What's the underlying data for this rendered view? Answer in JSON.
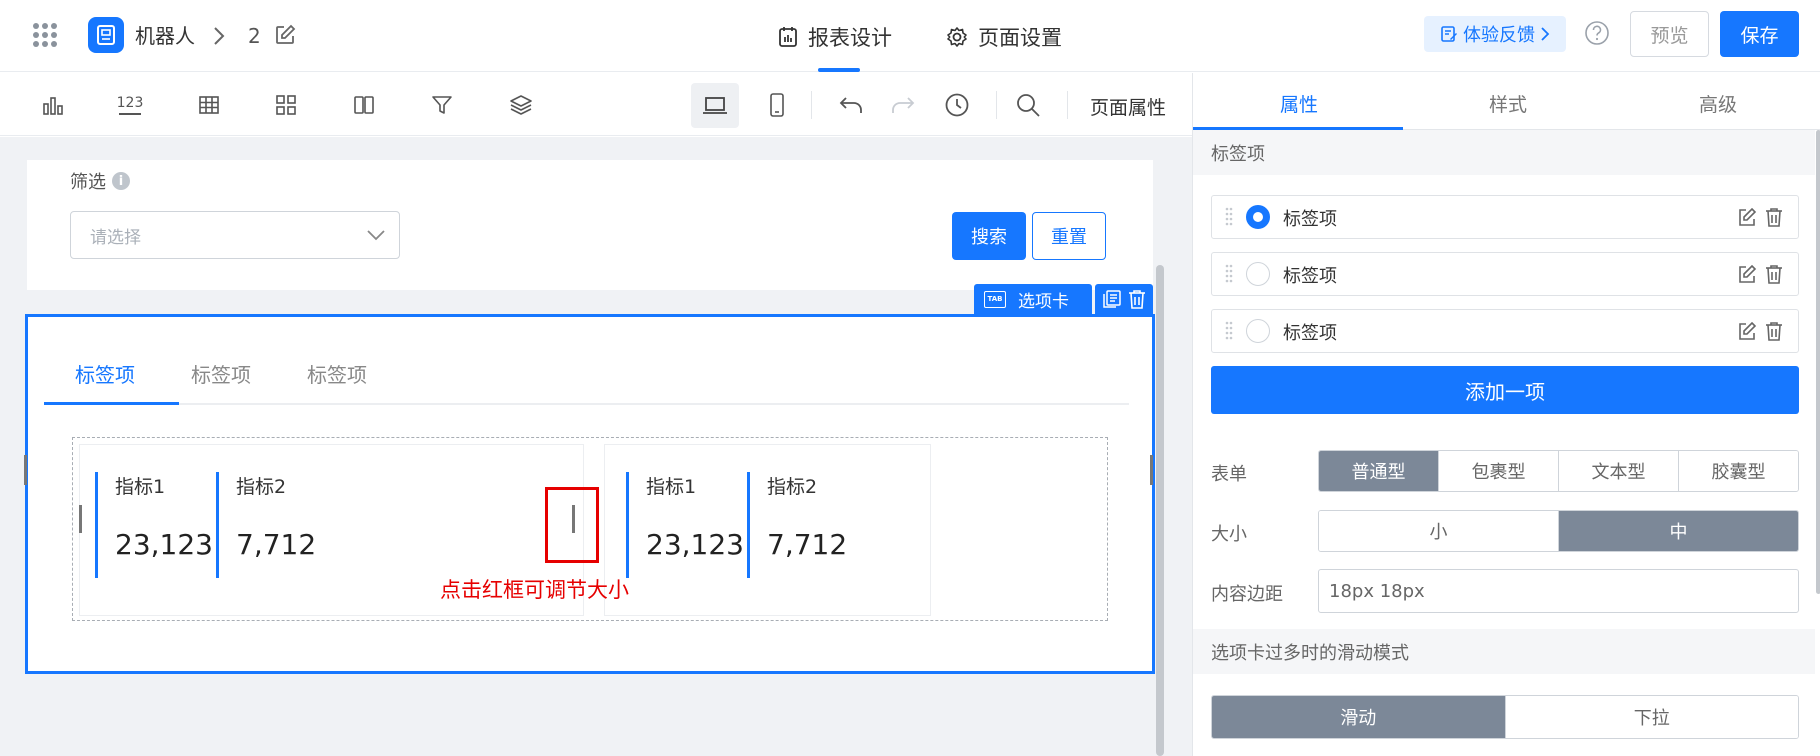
{
  "header": {
    "app_name": "机器人",
    "page_number": "2",
    "tabs": [
      {
        "label": "报表设计",
        "active": true
      },
      {
        "label": "页面设置",
        "active": false
      }
    ],
    "feedback_label": "体验反馈",
    "preview_label": "预览",
    "save_label": "保存"
  },
  "toolbar": {
    "icons": [
      "bar-chart-icon",
      "number-icon",
      "table-icon",
      "grid-layout-icon",
      "columns-icon",
      "filter-icon",
      "layers-icon",
      "desktop-icon",
      "mobile-icon",
      "undo-icon",
      "redo-icon",
      "history-icon",
      "search-icon"
    ],
    "number_icon_text": "123",
    "page_props_label": "页面属性"
  },
  "filter": {
    "label": "筛选",
    "info_glyph": "i",
    "placeholder": "请选择",
    "search_label": "搜索",
    "reset_label": "重置"
  },
  "tab_component": {
    "badge_label": "选项卡",
    "badge_icon_text": "TAB",
    "tabs": [
      "标签项",
      "标签项",
      "标签项"
    ],
    "active_tab": 0,
    "kpi_cards": [
      {
        "items": [
          {
            "label": "指标1",
            "value": "23,123"
          },
          {
            "label": "指标2",
            "value": "7,712"
          }
        ]
      },
      {
        "items": [
          {
            "label": "指标1",
            "value": "23,123"
          },
          {
            "label": "指标2",
            "value": "7,712"
          }
        ]
      }
    ],
    "annotation": "点击红框可调节大小"
  },
  "panel": {
    "tabs": [
      "属性",
      "样式",
      "高级"
    ],
    "active_tab": 0,
    "tag_section_title": "标签项",
    "tag_items": [
      {
        "label": "标签项",
        "checked": true
      },
      {
        "label": "标签项",
        "checked": false
      },
      {
        "label": "标签项",
        "checked": false
      }
    ],
    "add_item_label": "添加一项",
    "form": {
      "label": "表单",
      "options": [
        "普通型",
        "包裹型",
        "文本型",
        "胶囊型"
      ],
      "selected": "普通型"
    },
    "size": {
      "label": "大小",
      "options": [
        "小",
        "中"
      ],
      "selected": "中"
    },
    "padding": {
      "label": "内容边距",
      "value": "18px 18px"
    },
    "scroll_section_title": "选项卡过多时的滑动模式",
    "scroll_mode": {
      "options": [
        "滑动",
        "下拉"
      ],
      "selected": "滑动"
    }
  },
  "colors": {
    "primary": "#1677ff",
    "annotation_red": "#e60000",
    "segment_active": "#7c8898",
    "canvas_bg": "#f0f2f5"
  }
}
